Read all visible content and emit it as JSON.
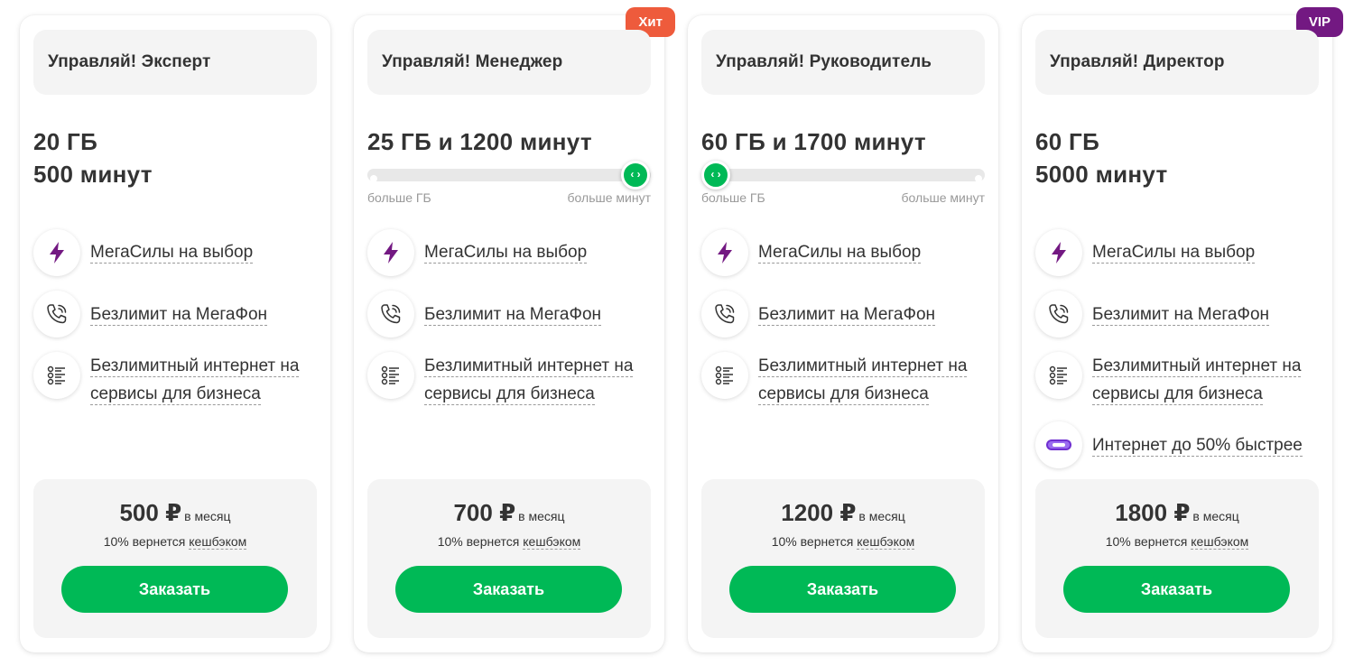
{
  "feature_labels": {
    "megasily": "МегаСилы на выбор",
    "unlimited_calls": "Безлимит на МегаФон",
    "biz_internet_line1": "Безлимитный интернет на",
    "biz_internet_line2": "сервисы для бизнеса",
    "faster_internet": "Интернет до 50% быстрее"
  },
  "slider_labels": {
    "left": "больше ГБ",
    "right": "больше минут"
  },
  "common": {
    "per_month": "в месяц",
    "cashback_prefix": "10% вернется",
    "cashback_link": "кешбэком",
    "order_button": "Заказать",
    "currency": "₽"
  },
  "colors": {
    "accent_green": "#00b956",
    "hit_badge": "#ee5b3c",
    "vip_badge": "#731982",
    "megasily_icon": "#731982"
  },
  "icons": {
    "megasily": "lightning-icon",
    "unlimited_calls": "phone-call-icon",
    "biz_internet": "list-icon",
    "faster_internet": "speed-logo-icon",
    "slider_knob": "chevrons-left-right-icon"
  },
  "plans": [
    {
      "title": "Управляй! Эксперт",
      "volume_line1": "20 ГБ",
      "volume_line2": "500 минут",
      "price": "500 ₽",
      "badge": ""
    },
    {
      "title": "Управляй! Менеджер",
      "volume_line1": "25 ГБ и 1200 минут",
      "price": "700 ₽",
      "badge": "Хит",
      "slider_position": 1.0
    },
    {
      "title": "Управляй! Руководитель",
      "volume_line1": "60 ГБ и 1700 минут",
      "price": "1200 ₽",
      "badge": "",
      "slider_position": 0.0
    },
    {
      "title": "Управляй! Директор",
      "volume_line1": "60 ГБ",
      "volume_line2": "5000 минут",
      "price": "1800 ₽",
      "badge": "VIP"
    }
  ]
}
